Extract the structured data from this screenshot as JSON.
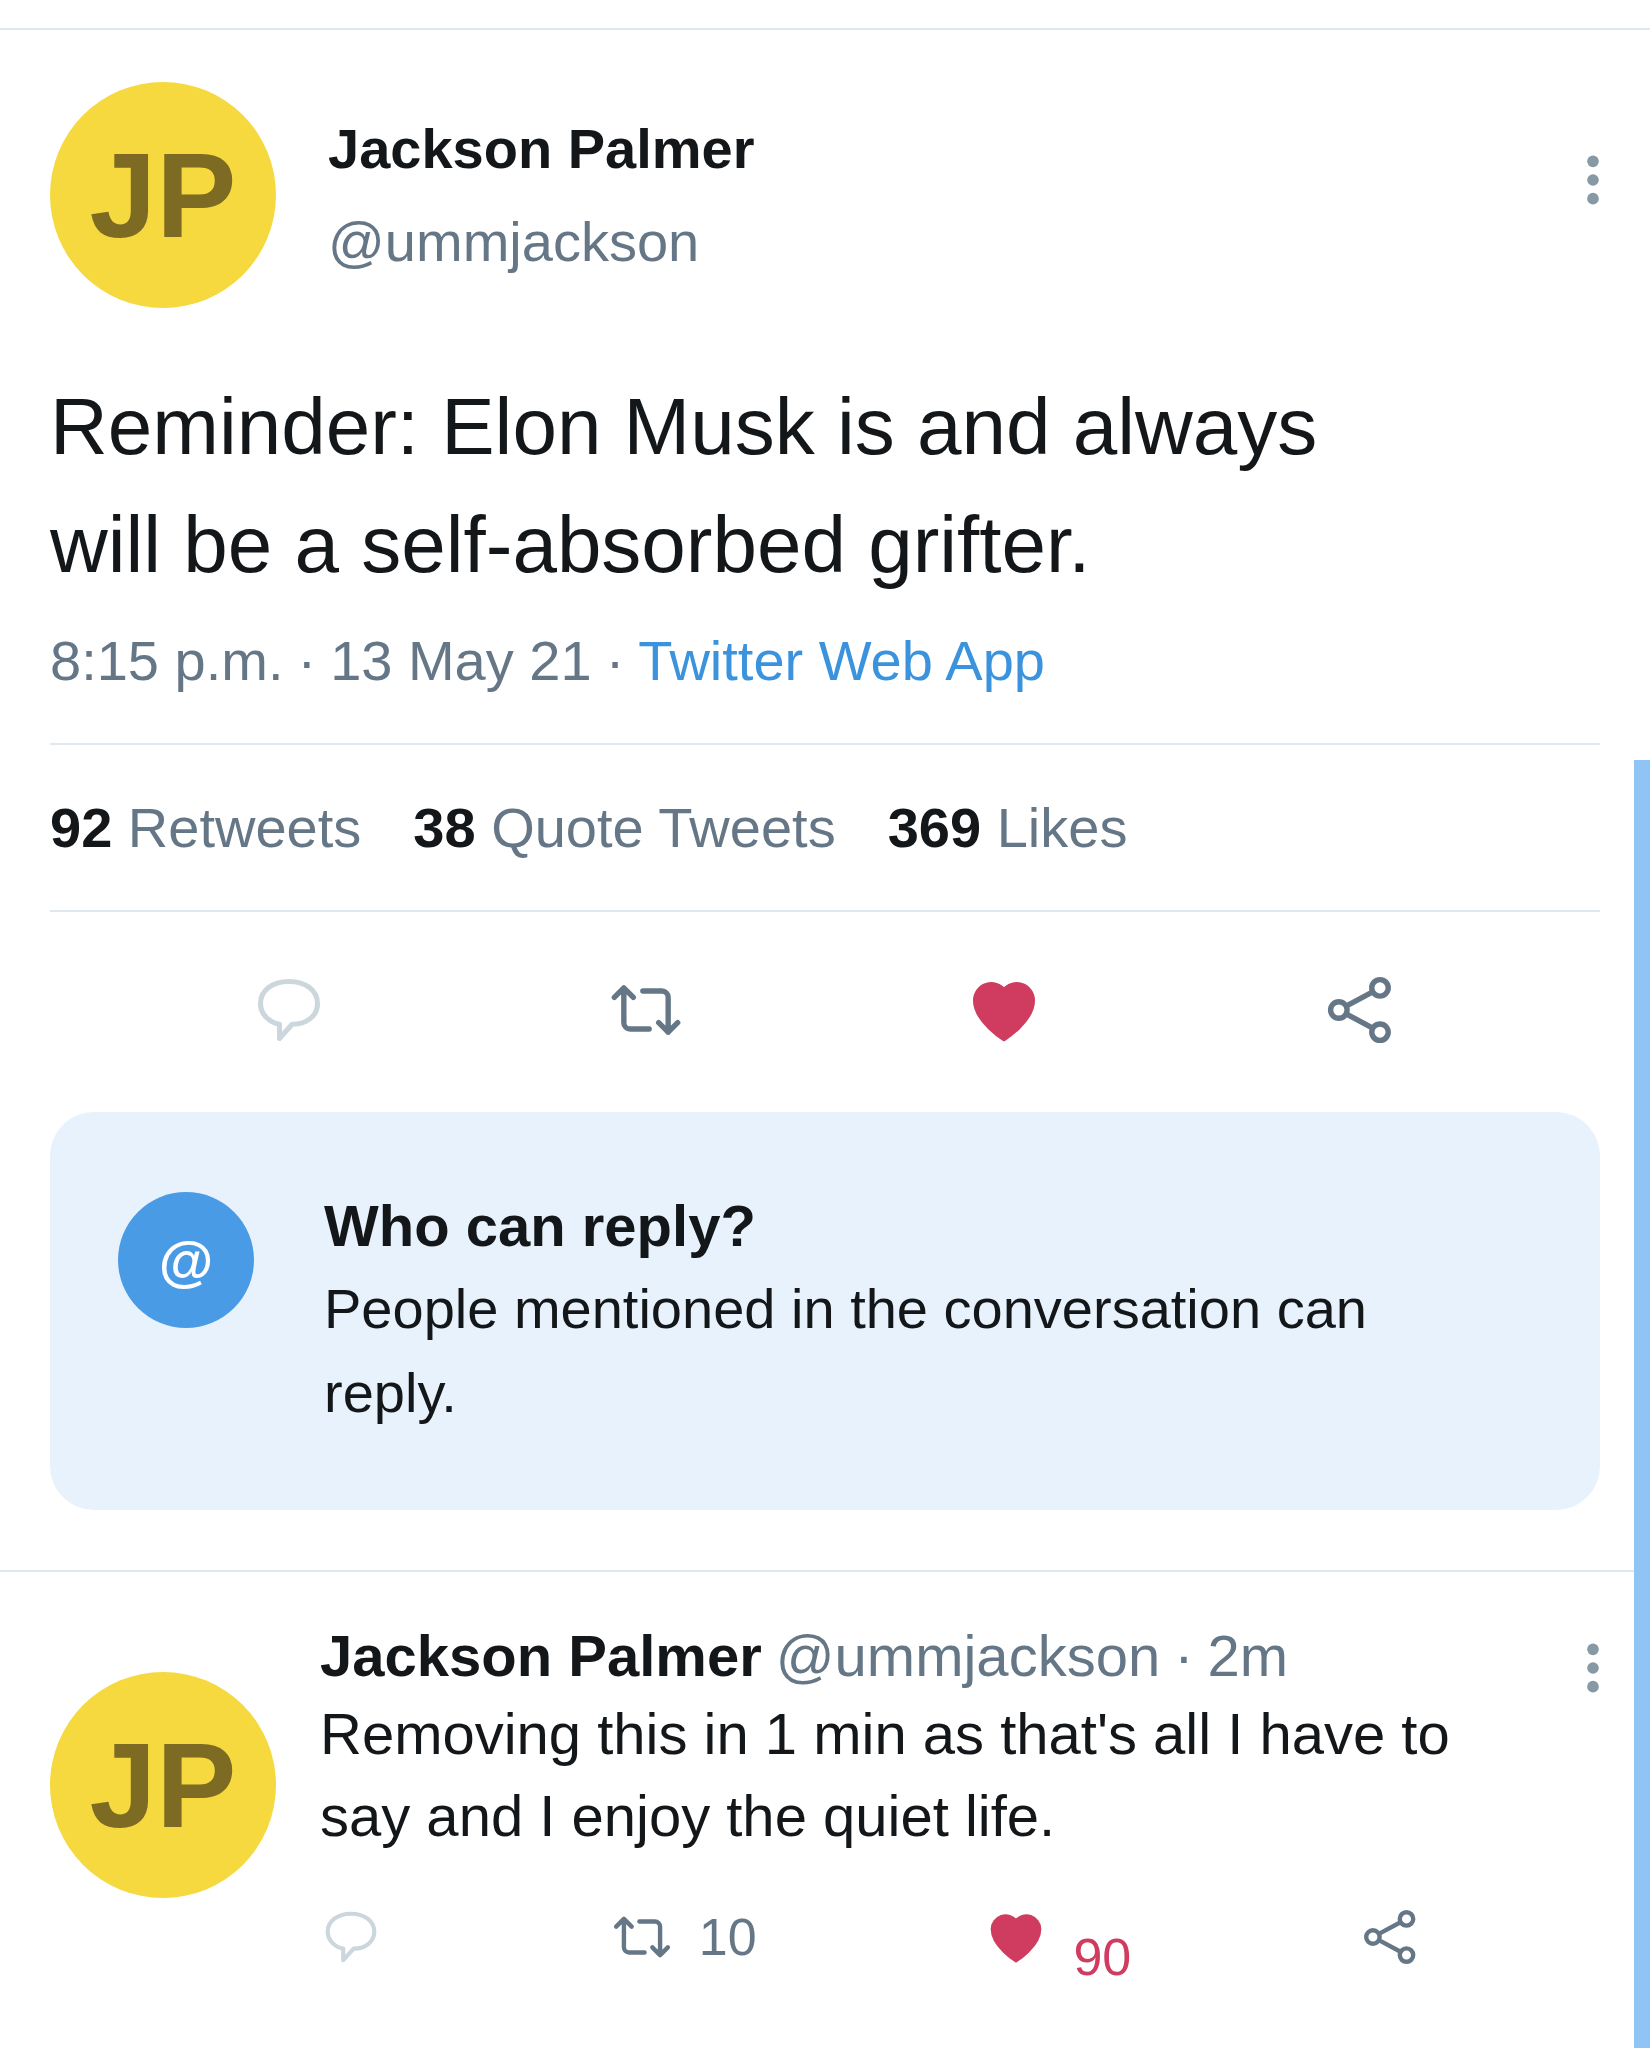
{
  "tweet": {
    "avatar_text": "JP",
    "name": "Jackson Palmer",
    "handle": "@ummjackson",
    "text": "Reminder: Elon Musk is and always will be a self-absorbed grifter.",
    "time": "8:15 p.m.",
    "date": "13 May 21",
    "source": "Twitter Web App",
    "separator": "·",
    "liked": true,
    "stats": [
      {
        "count": "92",
        "label": "Retweets"
      },
      {
        "count": "38",
        "label": "Quote Tweets"
      },
      {
        "count": "369",
        "label": "Likes"
      }
    ]
  },
  "reply_notice": {
    "icon_text": "@",
    "title": "Who can reply?",
    "text": "People mentioned in the conversation can reply."
  },
  "reply": {
    "avatar_text": "JP",
    "name": "Jackson Palmer",
    "handle": "@ummjackson",
    "separator": "·",
    "time": "2m",
    "text": "Removing this in 1 min as that's all I have to say and I enjoy the quiet life.",
    "retweets": "10",
    "likes": "90",
    "liked": true
  }
}
